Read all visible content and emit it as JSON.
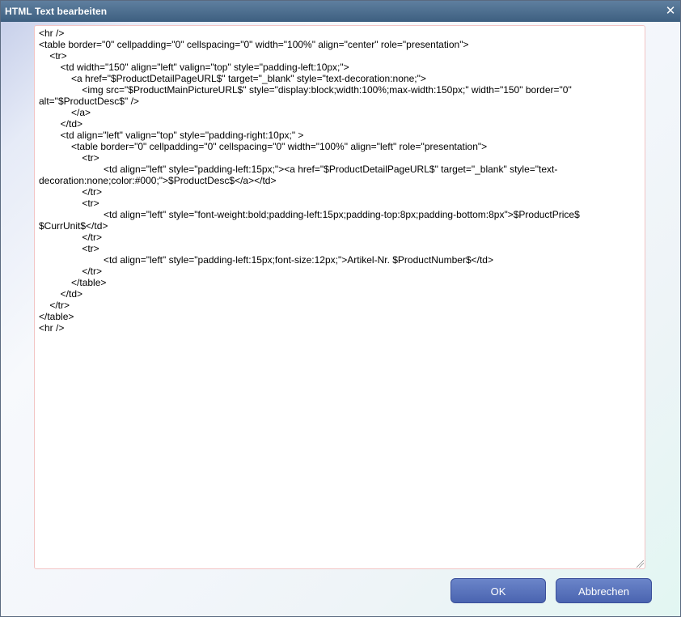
{
  "dialog": {
    "title": "HTML Text bearbeiten",
    "close_symbol": "✕"
  },
  "editor": {
    "content": "<hr />\n<table border=\"0\" cellpadding=\"0\" cellspacing=\"0\" width=\"100%\" align=\"center\" role=\"presentation\">\n\t<tr>\n\t\t<td width=\"150\" align=\"left\" valign=\"top\" style=\"padding-left:10px;\">\n\t\t\t<a href=\"$ProductDetailPageURL$\" target=\"_blank\" style=\"text-decoration:none;\">\n\t\t\t\t<img src=\"$ProductMainPictureURL$\" style=\"display:block;width:100%;max-width:150px;\" width=\"150\" border=\"0\" alt=\"$ProductDesc$\" />\n\t\t\t</a>\n\t\t</td>\n\t\t<td align=\"left\" valign=\"top\" style=\"padding-right:10px;\" >\n\t\t\t<table border=\"0\" cellpadding=\"0\" cellspacing=\"0\" width=\"100%\" align=\"left\" role=\"presentation\">\n\t\t\t\t<tr>\n\t\t\t\t\t\t<td align=\"left\" style=\"padding-left:15px;\"><a href=\"$ProductDetailPageURL$\" target=\"_blank\" style=\"text-decoration:none;color:#000;\">$ProductDesc$</a></td>\n\t\t\t\t</tr>\n\t\t\t\t<tr>\n\t\t\t\t\t\t<td align=\"left\" style=\"font-weight:bold;padding-left:15px;padding-top:8px;padding-bottom:8px\">$ProductPrice$ $CurrUnit$</td>\n\t\t\t\t</tr>\n\t\t\t\t<tr>\n\t\t\t\t\t\t<td align=\"left\" style=\"padding-left:15px;font-size:12px;\">Artikel-Nr. $ProductNumber$</td>\n\t\t\t\t</tr>\n\t\t\t</table>\n\t\t</td>\n\t</tr>\n</table>\n<hr />"
  },
  "buttons": {
    "ok_label": "OK",
    "cancel_label": "Abbrechen"
  },
  "icons": {
    "close": "close-icon",
    "resize": "resize-grip-icon"
  },
  "colors": {
    "title_bar": "#4a6a8a",
    "button": "#5a74bd",
    "editor_border": "#f2c4c4"
  }
}
